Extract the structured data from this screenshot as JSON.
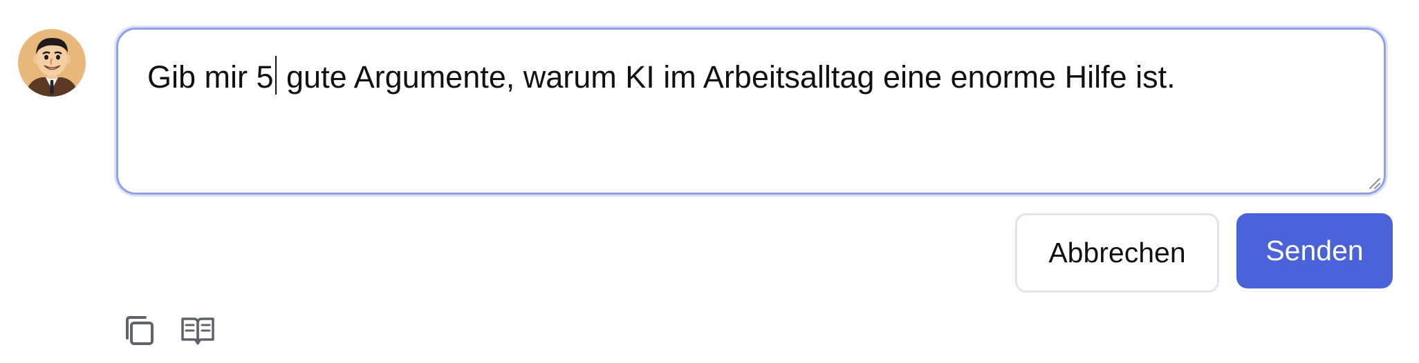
{
  "user": {
    "avatar_icon": "cartoon-man-avatar-icon"
  },
  "editor": {
    "text_before_caret": "Gib mir 5",
    "text_after_caret": " gute Argumente, warum KI im Arbeitsalltag eine enorme Hilfe ist.",
    "focus_color": "#8fa0e6"
  },
  "actions": {
    "cancel_label": "Abbrechen",
    "send_label": "Senden",
    "send_color": "#4a63d9"
  },
  "message_tools": {
    "copy_icon": "copy-icon",
    "read_aloud_icon": "book-open-icon"
  }
}
